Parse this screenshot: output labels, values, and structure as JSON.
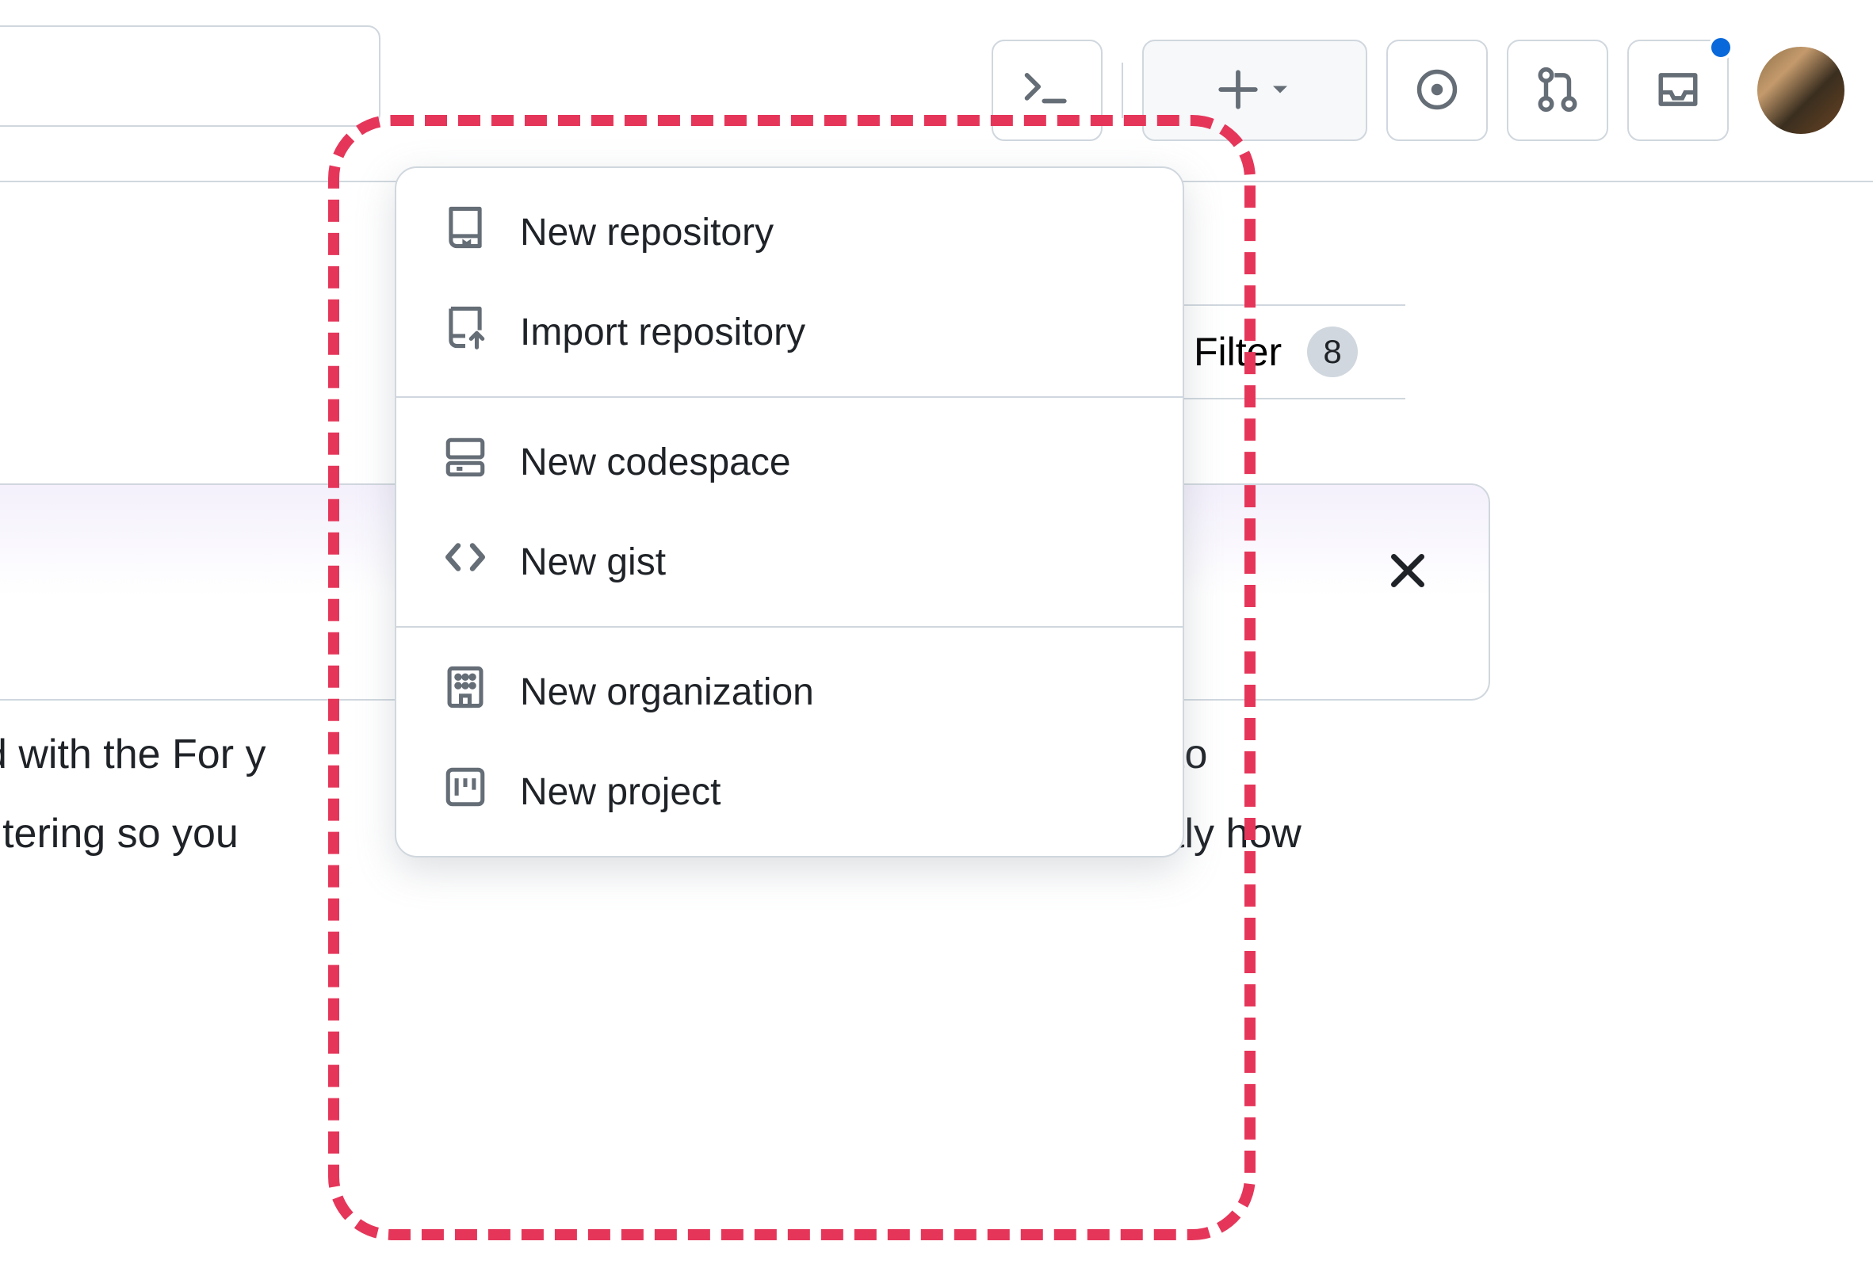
{
  "toolbar": {
    "command_palette_label": "Command palette",
    "create_label": "Create new",
    "issues_label": "Issues",
    "pull_requests_label": "Pull requests",
    "inbox_label": "Inbox"
  },
  "dropdown": {
    "sections": [
      [
        {
          "icon": "repo-icon",
          "label": "New repository"
        },
        {
          "icon": "repo-push-icon",
          "label": "Import repository"
        }
      ],
      [
        {
          "icon": "codespaces-icon",
          "label": "New codespace"
        },
        {
          "icon": "code-icon",
          "label": "New gist"
        }
      ],
      [
        {
          "icon": "organization-icon",
          "label": "New organization"
        },
        {
          "icon": "project-icon",
          "label": "New project"
        }
      ]
    ]
  },
  "filter": {
    "label": "Filter",
    "count": "8"
  },
  "feed_card": {
    "text_left_line1": "d with the For y",
    "text_left_line2": "iltering so you",
    "text_right_line1": "to",
    "text_right_line2": "tly how"
  }
}
